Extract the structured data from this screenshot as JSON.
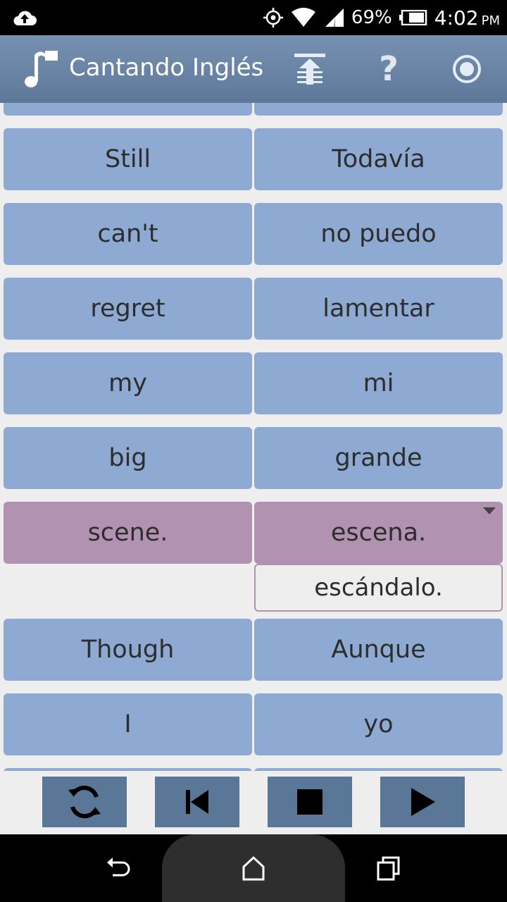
{
  "status_bar": {
    "battery_percent": "69%",
    "time": "4:02",
    "ampm": "PM",
    "icons": [
      "cloud-upload-icon",
      "gps-icon",
      "wifi-icon",
      "signal-icon",
      "battery-icon"
    ]
  },
  "app_bar": {
    "title": "Cantando Inglés",
    "icons": [
      "music-note-icon",
      "auto-scroll-icon",
      "help-icon",
      "record-icon"
    ],
    "help_label": "?"
  },
  "rows": [
    {
      "english": "Still",
      "spanish": "Todavía"
    },
    {
      "english": "can't",
      "spanish": "no puedo"
    },
    {
      "english": "regret",
      "spanish": "lamentar"
    },
    {
      "english": "my",
      "spanish": "mi"
    },
    {
      "english": "big",
      "spanish": "grande"
    },
    {
      "english": "scene.",
      "spanish": "escena.",
      "selected": true,
      "alternative": "escándalo."
    },
    {
      "english": "Though",
      "spanish": "Aunque"
    },
    {
      "english": "I",
      "spanish": "yo"
    }
  ],
  "controls": [
    "repeat-icon",
    "skip-previous-icon",
    "stop-icon",
    "play-icon"
  ],
  "nav_bar": [
    "back-icon",
    "home-icon",
    "recent-apps-icon"
  ],
  "colors": {
    "cell": "#8eaad3",
    "selected_cell": "#b292b1",
    "app_bar": "#6884a8",
    "control_button": "#5a7797"
  }
}
